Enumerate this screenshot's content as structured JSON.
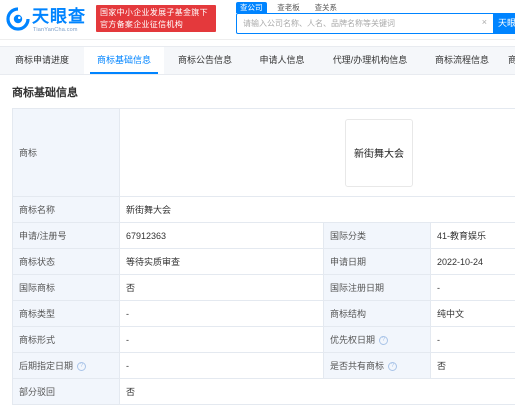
{
  "header": {
    "logo_text": "天眼查",
    "logo_sub": "TianYanCha.com",
    "banner_line1": "国家中小企业发展子基金旗下",
    "banner_line2": "官方备案企业征信机构",
    "search_tabs": [
      "查公司",
      "查老板",
      "查关系"
    ],
    "search_placeholder": "请输入公司名称、人名、品牌名称等关键词",
    "search_clear": "×",
    "search_button": "天眼"
  },
  "tabs": [
    "商标申请进度",
    "商标基础信息",
    "商标公告信息",
    "申请人信息",
    "代理/办理机构信息",
    "商标流程信息",
    "商"
  ],
  "active_tab": 1,
  "section_title": "商标基础信息",
  "table": {
    "image_label": "商标",
    "image_text": "新街舞大会",
    "name_label": "商标名称",
    "name_value": "新街舞大会",
    "rows": [
      {
        "l1": "申请/注册号",
        "v1": "67912363",
        "l2": "国际分类",
        "v2": "41-教育娱乐"
      },
      {
        "l1": "商标状态",
        "v1": "等待实质审查",
        "l2": "申请日期",
        "v2": "2022-10-24"
      },
      {
        "l1": "国际商标",
        "v1": "否",
        "l2": "国际注册日期",
        "v2": "-"
      },
      {
        "l1": "商标类型",
        "v1": "-",
        "l2": "商标结构",
        "v2": "纯中文"
      },
      {
        "l1": "商标形式",
        "v1": "-",
        "l2": "优先权日期",
        "v2": "-"
      },
      {
        "l1": "后期指定日期",
        "v1": "-",
        "l2": "是否共有商标",
        "v2": "否"
      }
    ],
    "partial_label": "部分驳回",
    "partial_value": "否"
  },
  "colors": {
    "brand": "#0084ff",
    "banner": "#e4393c",
    "label_bg": "#f2f6fc"
  },
  "icons": {
    "logo": "tianyancha-eye-logo",
    "help": "question-circle-icon",
    "clear": "close-icon"
  }
}
